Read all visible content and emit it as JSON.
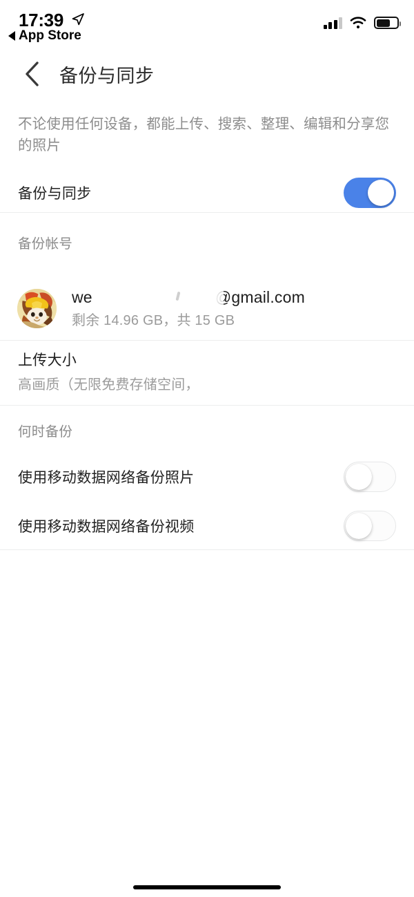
{
  "status_bar": {
    "time": "17:39",
    "back_app_label": "App Store",
    "location_icon": "location-arrow-icon",
    "signal_icon": "cellular-signal-icon",
    "wifi_icon": "wifi-icon",
    "battery_icon": "battery-icon",
    "battery_level_percent": 60,
    "signal_bars_filled": 3,
    "signal_bars_total": 4
  },
  "navbar": {
    "back_icon": "chevron-left-icon",
    "title": "备份与同步"
  },
  "description": "不论使用任何设备，都能上传、搜索、整理、编辑和分享您的照片",
  "backup_sync_row": {
    "label": "备份与同步",
    "toggle_state": "on",
    "toggle_color": "#4a82e8"
  },
  "account_section": {
    "header": "备份帐号",
    "avatar_icon": "user-avatar-image",
    "email_prefix": "we",
    "email_suffix": "@gmail.com",
    "email_redacted": true,
    "storage": "剩余 14.96 GB，共 15 GB"
  },
  "upload_size": {
    "title": "上传大小",
    "subtitle": "高画质（无限免费存储空间，"
  },
  "when_backup_section": {
    "header": "何时备份",
    "rows": [
      {
        "label": "使用移动数据网络备份照片",
        "toggle_state": "off"
      },
      {
        "label": "使用移动数据网络备份视频",
        "toggle_state": "off"
      }
    ]
  },
  "home_indicator": "home-indicator-bar"
}
